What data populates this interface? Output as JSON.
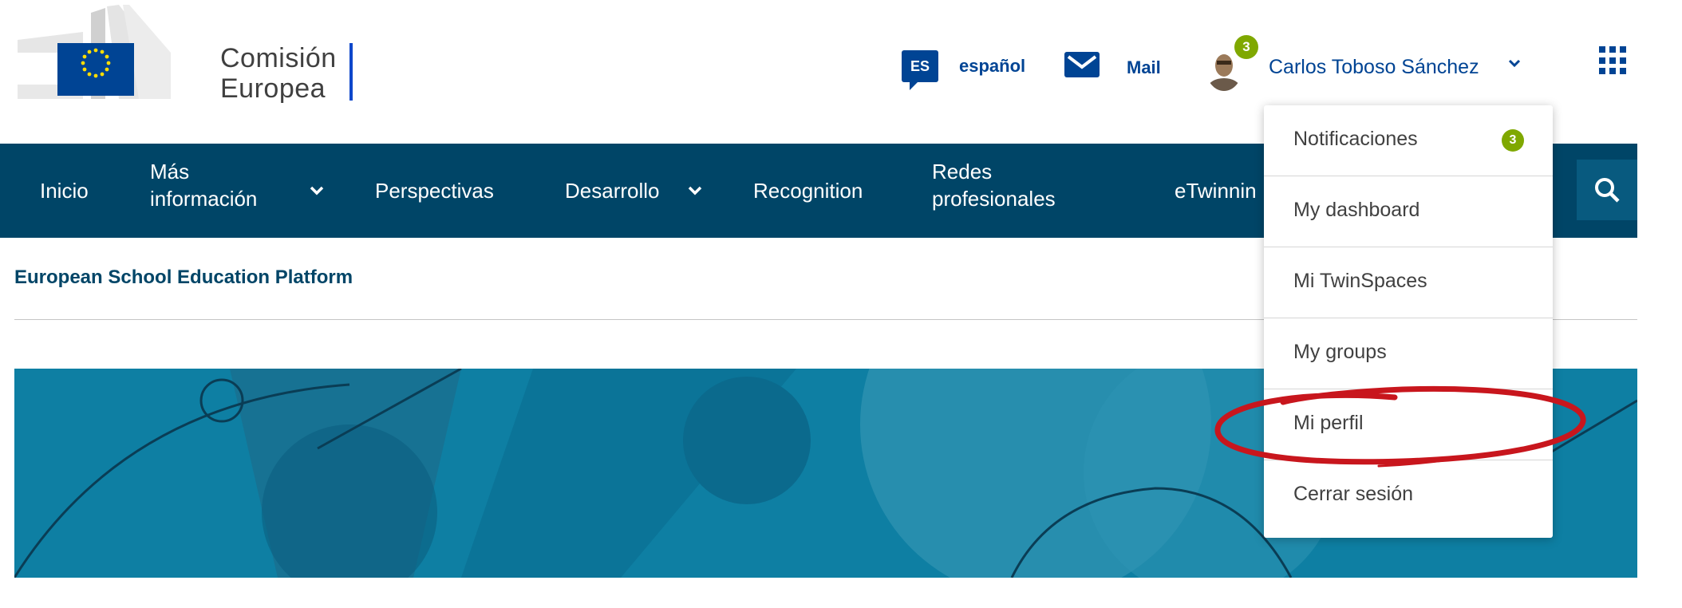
{
  "logo": {
    "line1": "Comisión",
    "line2": "Europea"
  },
  "header": {
    "language_code": "ES",
    "language_label": "español",
    "mail_label": "Mail",
    "notifications_count": "3",
    "user_name": "Carlos Toboso Sánchez"
  },
  "nav": {
    "items": [
      {
        "label": "Inicio"
      },
      {
        "label_line1": "Más",
        "label_line2": "información"
      },
      {
        "label": "Perspectivas"
      },
      {
        "label": "Desarrollo"
      },
      {
        "label": "Recognition"
      },
      {
        "label_line1": "Redes",
        "label_line2": "profesionales"
      },
      {
        "label": "eTwinnin"
      }
    ]
  },
  "breadcrumb": {
    "site_title": "European School Education Platform"
  },
  "user_menu": {
    "items": [
      {
        "label": "Notificaciones",
        "badge": "3"
      },
      {
        "label": "My dashboard"
      },
      {
        "label": "Mi TwinSpaces"
      },
      {
        "label": "My groups"
      },
      {
        "label": "Mi perfil"
      },
      {
        "label": "Cerrar sesión"
      }
    ]
  },
  "colors": {
    "navbar": "#004567",
    "brand_blue": "#004494",
    "badge_green": "#7fa800",
    "banner": "#0e7fa3",
    "annotation_red": "#c8161d"
  }
}
